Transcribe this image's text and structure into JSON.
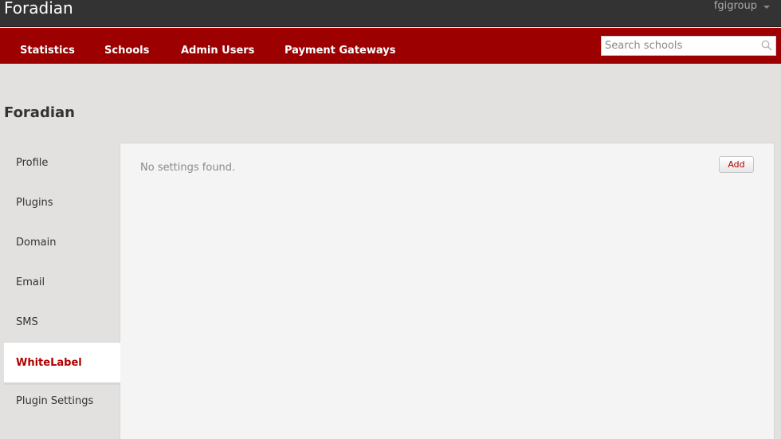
{
  "app": {
    "brand": "Foradian",
    "user": "fgigroup"
  },
  "nav": {
    "items": [
      {
        "label": "Statistics"
      },
      {
        "label": "Schools"
      },
      {
        "label": "Admin Users"
      },
      {
        "label": "Payment Gateways"
      }
    ],
    "search": {
      "placeholder": "Search schools",
      "value": "",
      "icon": "search-icon"
    }
  },
  "page": {
    "title": "Foradian"
  },
  "sidebar": {
    "active": "WhiteLabel",
    "items": [
      {
        "label": "Profile"
      },
      {
        "label": "Plugins"
      },
      {
        "label": "Domain"
      },
      {
        "label": "Email"
      },
      {
        "label": "SMS"
      },
      {
        "label": "WhiteLabel"
      },
      {
        "label": "Plugin Settings"
      }
    ]
  },
  "content": {
    "empty_message": "No settings found.",
    "add_label": "Add"
  },
  "colors": {
    "topbar": "#333333",
    "navbar": "#9c0000",
    "accent": "#b00000",
    "background": "#e3e1df"
  }
}
